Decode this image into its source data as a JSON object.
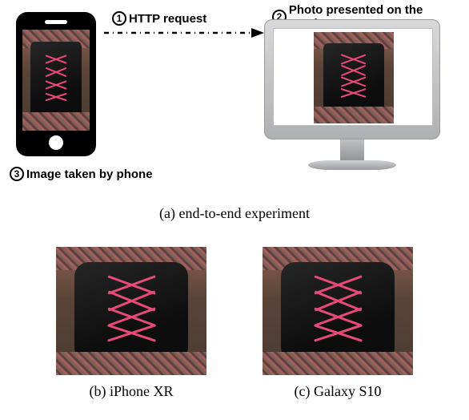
{
  "labels": {
    "step1": "HTTP request",
    "step2": "Photo presented on the monitor",
    "step3": "Image taken by phone",
    "num1": "1",
    "num2": "2",
    "num3": "3"
  },
  "captions": {
    "a": "(a) end-to-end experiment",
    "b": "(b) iPhone XR",
    "c": "(c) Galaxy S10"
  }
}
